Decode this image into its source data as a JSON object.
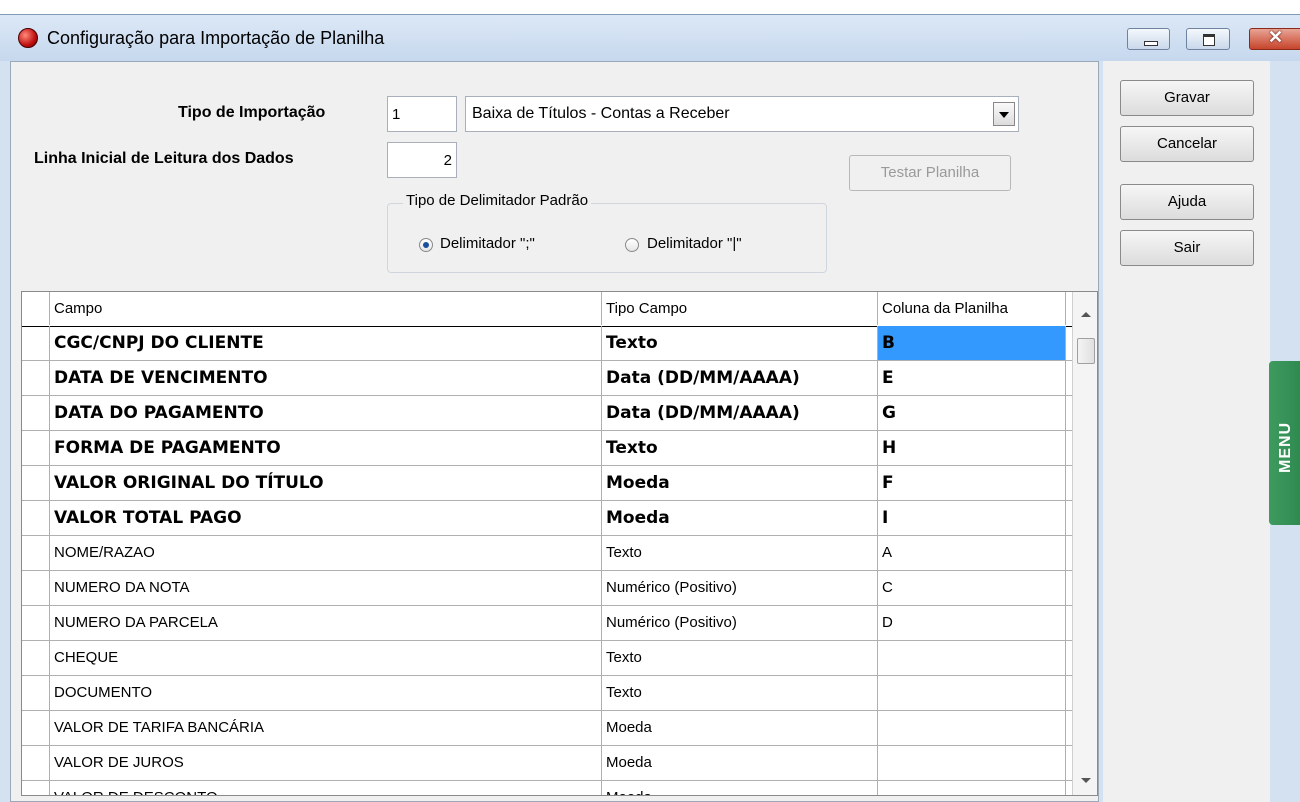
{
  "window": {
    "title": "Configuração para Importação de Planilha"
  },
  "form": {
    "tipo_importacao_label": "Tipo de Importação",
    "tipo_importacao_code": "1",
    "tipo_importacao_value": "Baixa de Títulos - Contas a Receber",
    "linha_inicial_label": "Linha Inicial de Leitura dos Dados",
    "linha_inicial_value": "2",
    "testar_label": "Testar Planilha",
    "delimitador_group_title": "Tipo de Delimitador Padrão",
    "delimitador_options": [
      {
        "label": "Delimitador \";\"",
        "checked": true
      },
      {
        "label": "Delimitador \"|\"",
        "checked": false
      }
    ]
  },
  "actions": {
    "gravar": "Gravar",
    "cancelar": "Cancelar",
    "ajuda": "Ajuda",
    "sair": "Sair"
  },
  "grid": {
    "columns": [
      "Campo",
      "Tipo Campo",
      "Coluna da Planilha"
    ],
    "rows": [
      {
        "campo": "CGC/CNPJ DO CLIENTE",
        "tipo": "Texto",
        "coluna": "B",
        "required": true,
        "selected": true
      },
      {
        "campo": "DATA DE VENCIMENTO",
        "tipo": "Data (DD/MM/AAAA)",
        "coluna": "E",
        "required": true
      },
      {
        "campo": "DATA DO PAGAMENTO",
        "tipo": "Data (DD/MM/AAAA)",
        "coluna": "G",
        "required": true
      },
      {
        "campo": "FORMA DE PAGAMENTO",
        "tipo": "Texto",
        "coluna": "H",
        "required": true
      },
      {
        "campo": "VALOR ORIGINAL DO TÍTULO",
        "tipo": "Moeda",
        "coluna": "F",
        "required": true
      },
      {
        "campo": "VALOR TOTAL PAGO",
        "tipo": "Moeda",
        "coluna": "I",
        "required": true
      },
      {
        "campo": "NOME/RAZAO",
        "tipo": "Texto",
        "coluna": "A",
        "required": false
      },
      {
        "campo": "NUMERO DA NOTA",
        "tipo": "Numérico (Positivo)",
        "coluna": "C",
        "required": false
      },
      {
        "campo": "NUMERO DA PARCELA",
        "tipo": "Numérico (Positivo)",
        "coluna": "D",
        "required": false
      },
      {
        "campo": "CHEQUE",
        "tipo": "Texto",
        "coluna": "",
        "required": false
      },
      {
        "campo": "DOCUMENTO",
        "tipo": "Texto",
        "coluna": "",
        "required": false
      },
      {
        "campo": "VALOR DE TARIFA BANCÁRIA",
        "tipo": "Moeda",
        "coluna": "",
        "required": false
      },
      {
        "campo": "VALOR DE JUROS",
        "tipo": "Moeda",
        "coluna": "",
        "required": false
      },
      {
        "campo": "VALOR DE DESCONTO",
        "tipo": "Moeda",
        "coluna": "",
        "required": false
      }
    ]
  },
  "side_tab": {
    "label": "MENU"
  },
  "colors": {
    "selection": "#3399ff",
    "menu_tab": "#3e9b5f"
  }
}
